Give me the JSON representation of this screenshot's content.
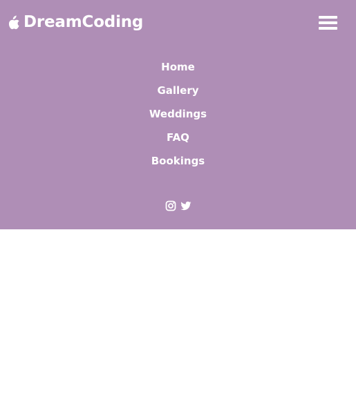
{
  "brand": {
    "name": "DreamCoding",
    "icon": "apple-icon"
  },
  "navbar": {
    "background": "#af8eb6",
    "toggle_icon": "hamburger-menu-icon"
  },
  "menu": {
    "items": [
      {
        "label": "Home"
      },
      {
        "label": "Gallery"
      },
      {
        "label": "Weddings"
      },
      {
        "label": "FAQ"
      },
      {
        "label": "Bookings"
      }
    ]
  },
  "social": {
    "icons": [
      "instagram-icon",
      "twitter-icon"
    ]
  }
}
